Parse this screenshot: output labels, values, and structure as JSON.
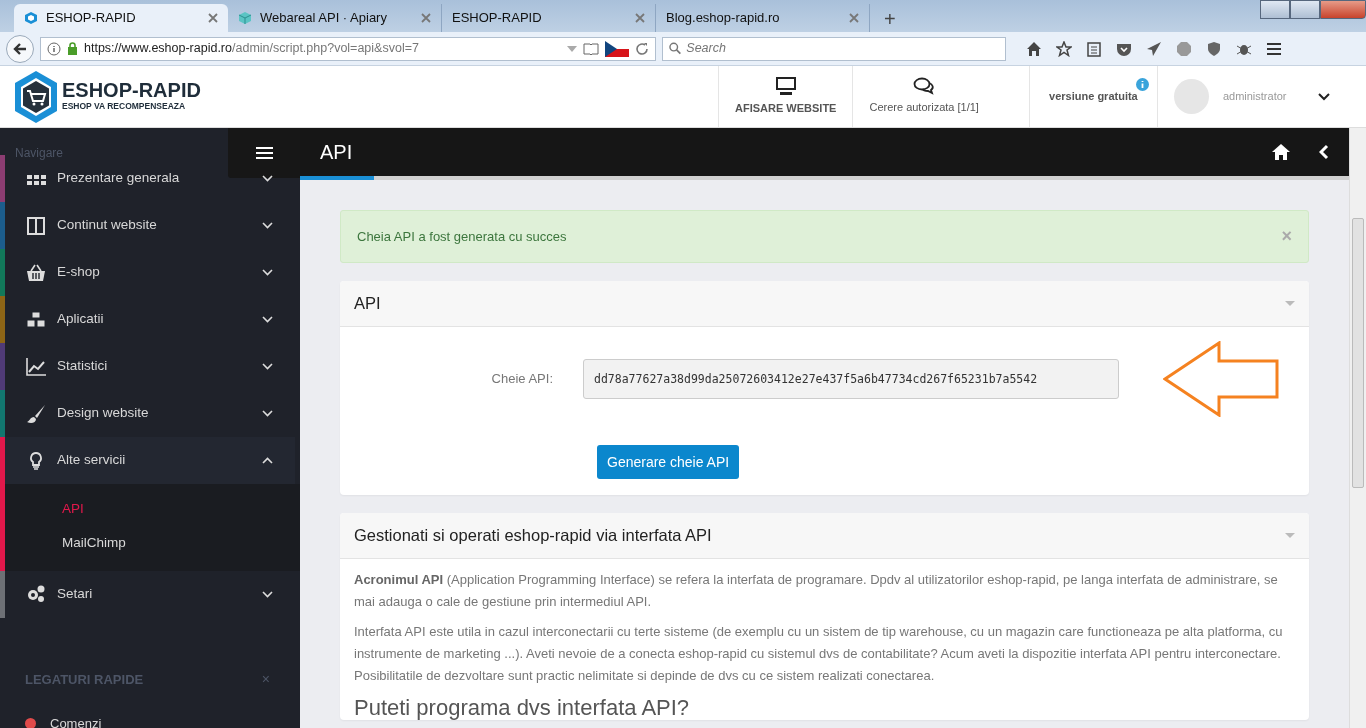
{
  "browser": {
    "tabs": [
      {
        "title": "ESHOP-RAPID",
        "selected": true
      },
      {
        "title": "Webareal API · Apiary",
        "selected": false
      },
      {
        "title": "ESHOP-RAPID",
        "selected": false
      },
      {
        "title": "Blog.eshop-rapid.ro",
        "selected": false
      }
    ],
    "new_tab": "+",
    "url": {
      "host": "https://www.eshop-rapid.ro",
      "path": "/admin/script.php?vol=api&svol=7"
    },
    "search": {
      "placeholder": "Search"
    }
  },
  "header": {
    "logo": {
      "title": "ESHOP-RAPID",
      "subtitle": "ESHOP VA RECOMPENSEAZA"
    },
    "buttons": [
      {
        "label": "AFISARE WEBSITE"
      },
      {
        "label": "Cerere autorizata [1/1]"
      }
    ],
    "version": "versiune gratuita",
    "user": "administrator"
  },
  "sidebar": {
    "nav_label": "Navigare",
    "items": [
      {
        "label": "Prezentare generala",
        "color": "#8c3d72",
        "expanded": false
      },
      {
        "label": "Continut website",
        "color": "#1c5d8c",
        "expanded": false
      },
      {
        "label": "E-shop",
        "color": "#12795a",
        "expanded": false
      },
      {
        "label": "Aplicatii",
        "color": "#8d6516",
        "expanded": false
      },
      {
        "label": "Statistici",
        "color": "#503b77",
        "expanded": false
      },
      {
        "label": "Design website",
        "color": "#12776f",
        "expanded": false
      },
      {
        "label": "Alte servicii",
        "color": "#e2184b",
        "expanded": true,
        "children": [
          {
            "label": "API",
            "selected": true
          },
          {
            "label": "MailChimp",
            "selected": false
          }
        ]
      },
      {
        "label": "Setari",
        "color": "#6d7075",
        "expanded": false
      }
    ],
    "quick_links": {
      "title": "LEGATURI RAPIDE",
      "close": "×",
      "links": [
        {
          "label": "Comenzi",
          "color": "#e04b4b"
        }
      ]
    }
  },
  "page": {
    "title": "API",
    "alert": {
      "text": "Cheia API a fost generata cu succes",
      "close": "×"
    },
    "api_panel": {
      "title": "API",
      "field_label": "Cheie API:",
      "value": "dd78a77627a38d99da25072603412e27e437f5a6b47734cd267f65231b7a5542",
      "button": "Generare cheie API"
    },
    "info_panel": {
      "title": "Gestionati si operati eshop-rapid via interfata API",
      "paragraphs": [
        "**Acronimul API** (Application Programming Interface) se refera la interfata de programare. Dpdv al utilizatorilor eshop-rapid, pe langa interfata de administrare, se mai adauga o cale de gestiune prin intermediul API.",
        "Interfata API este utila in cazul interconectarii cu terte sisteme (de exemplu cu un sistem de tip warehouse, cu un magazin care functioneaza pe alta platforma, cu instrumente de marketing ...). Aveti nevoie de a conecta eshop-rapid cu sistemul dvs de contabilitate? Acum aveti la dispozitie interfata API pentru interconectare. Posibilitatile de dezvoltare sunt practic nelimitate si depinde de dvs cu ce sistem realizati conectarea."
      ],
      "heading": "Puteti programa dvs interfata API?"
    }
  }
}
